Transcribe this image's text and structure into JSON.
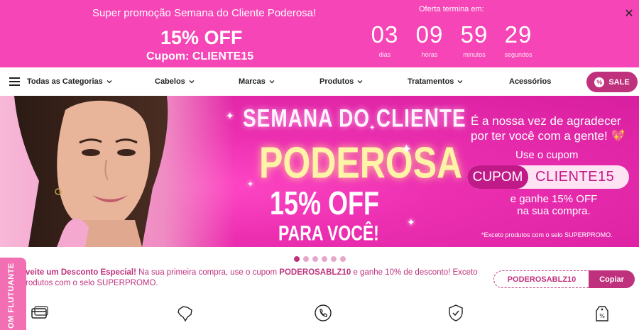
{
  "promo": {
    "title": "Super promoção Semana do Cliente Poderosa!",
    "off": "15% OFF",
    "coupon": "Cupom: CLIENTE15",
    "offer_label": "Oferta termina em:",
    "countdown": [
      {
        "value": "03",
        "label": "dias"
      },
      {
        "value": "09",
        "label": "horas"
      },
      {
        "value": "59",
        "label": "minutos"
      },
      {
        "value": "29",
        "label": "segundos"
      }
    ],
    "close": "✕"
  },
  "nav": {
    "items": [
      "Todas as Categorias",
      "Cabelos",
      "Marcas",
      "Produtos",
      "Tratamentos",
      "Acessórios"
    ],
    "sale": "SALE",
    "sale_symbol": "%"
  },
  "banner": {
    "headline1": "SEMANA DO CLIENTE",
    "headline2": "PODEROSA",
    "headline3": "15% OFF",
    "headline4": "PARA VOCÊ!",
    "right_line1": "É a nossa vez de agradecer por ter você com a gente! 💖",
    "right_line2": "Use o cupom",
    "coupon_left": "CUPOM",
    "coupon_right": "CLIENTE15",
    "right_line3": "e ganhe 15% OFF na sua compra.",
    "note": "*Exceto produtos com o selo SUPERPROMO."
  },
  "carousel": {
    "count": 6,
    "active": 0
  },
  "discount": {
    "bold1": "veite um Desconto Especial!",
    "text1": " Na sua primeira compra, use o cupom ",
    "code_inline": "PODEROSABLZ10",
    "text2": " e ganhe 10% de desconto! Exceto",
    "line2": "rodutos com o selo SUPERPROMO.",
    "code": "PODEROSABLZ10",
    "copy": "Copiar"
  },
  "side_tab": "OM FLUTUANTE",
  "icons": [
    "card-icon",
    "brazil-map-icon",
    "phone-icon",
    "shield-check-icon",
    "discount-tag-icon"
  ],
  "colors": {
    "promo_bg": "#f645b6",
    "accent": "#c0317d"
  }
}
